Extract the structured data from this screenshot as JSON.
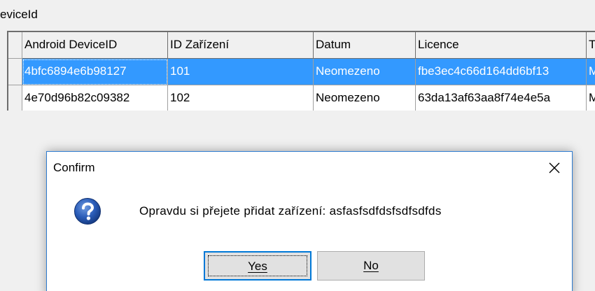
{
  "group": {
    "caption": "eviceId"
  },
  "grid": {
    "columns": [
      "Android DeviceID",
      "ID Zařízení",
      "Datum",
      "Licence",
      "T"
    ],
    "rows": [
      [
        "4bfc6894e6b98127",
        "101",
        "Neomezeno",
        "fbe3ec4c66d164dd6bf13",
        "M"
      ],
      [
        "4e70d96b82c09382",
        "102",
        "Neomezeno",
        "63da13af63aa8f74e4e5a",
        "M"
      ]
    ],
    "selected_row": 0
  },
  "dialog": {
    "title": "Confirm",
    "message": "Opravdu si přejete přidat zařízení: asfasfsdfdsfsdfsdfds",
    "icon": "question-icon",
    "close_icon": "close-icon",
    "buttons": {
      "yes": "Yes",
      "no": "No"
    }
  },
  "colors": {
    "selection": "#3399ff",
    "dialog_border": "#2d7bd0",
    "default_button_border": "#0078d7"
  }
}
